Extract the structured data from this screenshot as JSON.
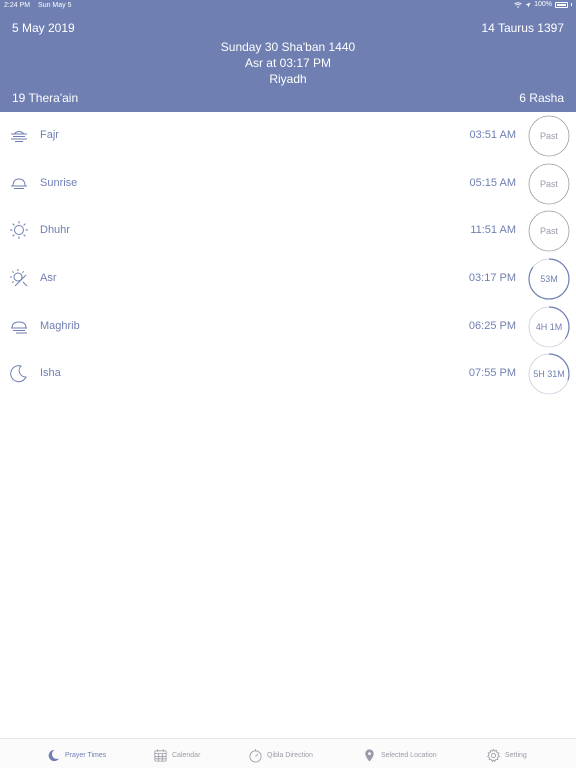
{
  "status_bar": {
    "time": "2:24 PM",
    "date": "Sun May 5",
    "battery": "100%"
  },
  "header": {
    "gregorian_date": "5 May 2019",
    "zodiac_date": "14 Taurus 1397",
    "hijri_date": "Sunday 30 Sha'ban 1440",
    "next_prayer": "Asr at 03:17 PM",
    "city": "Riyadh",
    "left_star": "19 Thera'ain",
    "right_star": "6 Rasha"
  },
  "prayers": [
    {
      "name": "Fajr",
      "time": "03:51 AM",
      "status": "Past",
      "progress": 0,
      "icon": "fajr-icon"
    },
    {
      "name": "Sunrise",
      "time": "05:15 AM",
      "status": "Past",
      "progress": 0,
      "icon": "sunrise-icon"
    },
    {
      "name": "Dhuhr",
      "time": "11:51 AM",
      "status": "Past",
      "progress": 0,
      "icon": "dhuhr-icon"
    },
    {
      "name": "Asr",
      "time": "03:17 PM",
      "status": "53M",
      "progress": 0.85,
      "icon": "asr-icon"
    },
    {
      "name": "Maghrib",
      "time": "06:25 PM",
      "status": "4H 1M",
      "progress": 0.35,
      "icon": "maghrib-icon"
    },
    {
      "name": "Isha",
      "time": "07:55 PM",
      "status": "5H 31M",
      "progress": 0.3,
      "icon": "isha-icon"
    }
  ],
  "tabs": [
    {
      "label": "Prayer Times",
      "icon": "crescent-icon",
      "active": true
    },
    {
      "label": "Calendar",
      "icon": "calendar-icon",
      "active": false
    },
    {
      "label": "Qibla Direction",
      "icon": "compass-icon",
      "active": false
    },
    {
      "label": "Selected Location",
      "icon": "location-pin-icon",
      "active": false
    },
    {
      "label": "Setting",
      "icon": "gear-icon",
      "active": false
    }
  ],
  "colors": {
    "accent": "#6f7fb2",
    "ring_past": "#9a9ca8",
    "tab_inactive": "#9a9ca8"
  }
}
